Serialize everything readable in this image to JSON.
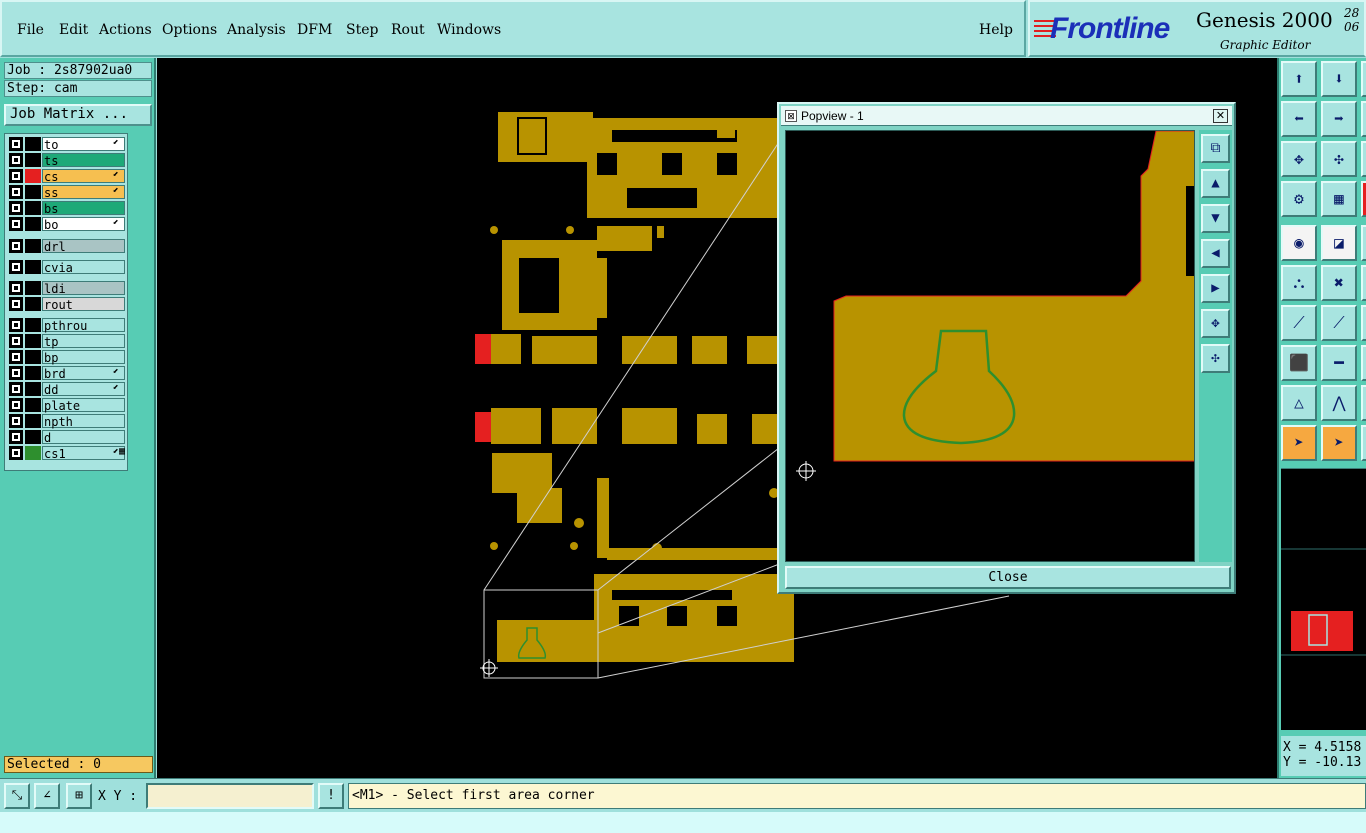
{
  "menu": {
    "file": "File",
    "edit": "Edit",
    "actions": "Actions",
    "options": "Options",
    "analysis": "Analysis",
    "dfm": "DFM",
    "step": "Step",
    "rout": "Rout",
    "windows": "Windows",
    "help": "Help"
  },
  "brand": {
    "logo": "Frontline",
    "product": "Genesis 2000",
    "subtitle": "Graphic Editor",
    "date_line1": "28",
    "date_line2": "06"
  },
  "job": {
    "job_label": "Job : 2s87902ua0",
    "step_label": "Step: cam",
    "matrix_button": "Job Matrix ..."
  },
  "layers": [
    {
      "name": "to",
      "color": "#ffffff",
      "swatch": "#000000",
      "arrow": "⬋"
    },
    {
      "name": "ts",
      "color": "#1ea978",
      "swatch": "#000000",
      "arrow": ""
    },
    {
      "name": "cs",
      "color": "#f6bf50",
      "swatch": "#e52020",
      "arrow": "⬋"
    },
    {
      "name": "ss",
      "color": "#f6bf50",
      "swatch": "#000000",
      "arrow": "⬋"
    },
    {
      "name": "bs",
      "color": "#1ea978",
      "swatch": "#000000",
      "arrow": ""
    },
    {
      "name": "bo",
      "color": "#ffffff",
      "swatch": "#000000",
      "arrow": "⬋"
    },
    {
      "name": "drl",
      "color": "#a9c4c4",
      "swatch": "#000000",
      "arrow": ""
    },
    {
      "name": "cvia",
      "color": "#a8e4e0",
      "swatch": "#000000",
      "arrow": ""
    },
    {
      "name": "ldi",
      "color": "#a9c4c4",
      "swatch": "#000000",
      "arrow": ""
    },
    {
      "name": "rout",
      "color": "#d8d8d8",
      "swatch": "#000000",
      "arrow": ""
    },
    {
      "name": "pthrou",
      "color": "#a8e4e0",
      "swatch": "#000000",
      "arrow": ""
    },
    {
      "name": "tp",
      "color": "#a8e4e0",
      "swatch": "#000000",
      "arrow": ""
    },
    {
      "name": "bp",
      "color": "#a8e4e0",
      "swatch": "#000000",
      "arrow": ""
    },
    {
      "name": "brd",
      "color": "#a8e4e0",
      "swatch": "#000000",
      "arrow": "⬋"
    },
    {
      "name": "dd",
      "color": "#a8e4e0",
      "swatch": "#000000",
      "arrow": "⬋"
    },
    {
      "name": "plate",
      "color": "#a8e4e0",
      "swatch": "#000000",
      "arrow": ""
    },
    {
      "name": "npth",
      "color": "#a8e4e0",
      "swatch": "#000000",
      "arrow": ""
    },
    {
      "name": "d",
      "color": "#a8e4e0",
      "swatch": "#000000",
      "arrow": ""
    },
    {
      "name": "cs1",
      "color": "#a8e4e0",
      "swatch": "#2e8f2e",
      "arrow": "⬋▦"
    }
  ],
  "selected": "Selected : 0",
  "popview": {
    "title": "Popview - 1",
    "close_button": "Close"
  },
  "coords": {
    "x": "X = 4.5158",
    "y": "Y = -10.13"
  },
  "status": {
    "xy_label": "X Y :",
    "input_value": "",
    "message": "<M1> - Select first area corner",
    "alert_icon": "!"
  },
  "colors": {
    "copper": "#b89300",
    "highlight": "#e52020",
    "outline": "#2e8f2e"
  }
}
